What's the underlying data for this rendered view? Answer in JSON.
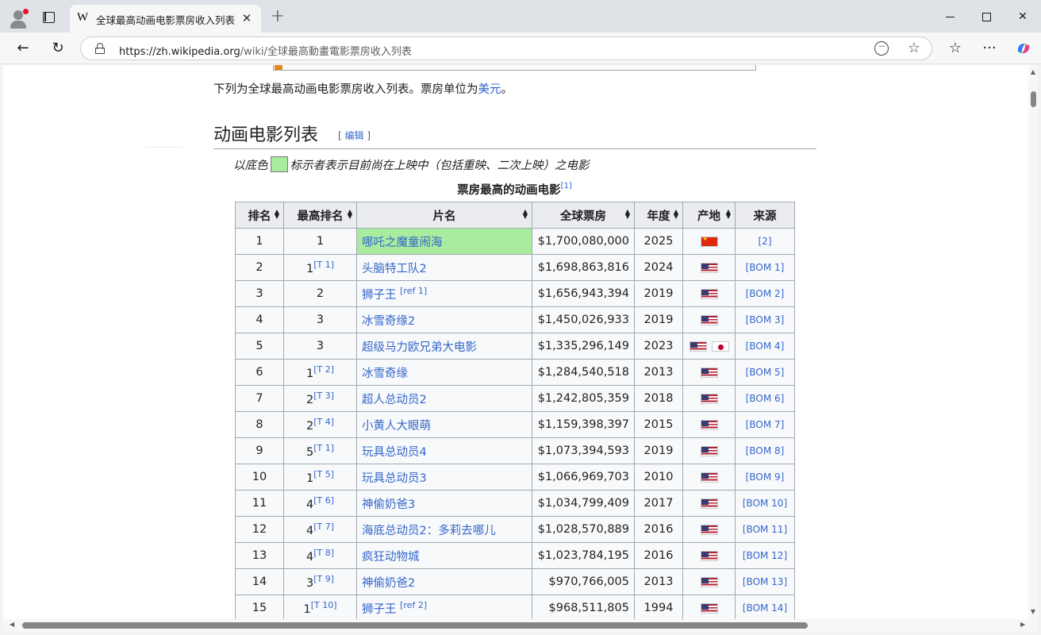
{
  "browser": {
    "tab_title": "全球最高动画电影票房收入列表 -",
    "tab_favicon": "W",
    "url_host": "https://zh.wikipedia.org",
    "url_path": "/wiki/全球最高動畫電影票房收入列表",
    "icons": {
      "profile": "profile-icon",
      "tabs": "tab-actions-icon",
      "close": "close-icon",
      "new_tab": "plus-icon",
      "back": "back-arrow-icon",
      "reload": "reload-icon",
      "lock": "lock-icon",
      "reader": "more-options-icon",
      "favorite": "star-icon",
      "favorites": "favorites-icon",
      "menu": "ellipsis-icon",
      "copilot": "copilot-icon"
    }
  },
  "article": {
    "intro_text": "下列为全球最高动画电影票房收入列表。票房单位为",
    "intro_link": "美元",
    "intro_end": "。",
    "section_title": "动画电影列表",
    "edit_open": "[",
    "edit_label": "编辑",
    "edit_close": "]",
    "note_prefix": "以底色",
    "note_suffix": "标示者表示目前尚在上映中（包括重映、二次上映）之电影",
    "caption": "票房最高的动画电影",
    "caption_ref": "[1]",
    "highlight_color": "#a9ec9f"
  },
  "table": {
    "headers": [
      "排名",
      "最高排名",
      "片名",
      "全球票房",
      "年度",
      "产地",
      "来源"
    ],
    "rows": [
      {
        "rank": "1",
        "peak": "1",
        "peak_ref": "",
        "title": "哪吒之魔童闹海",
        "title_ref": "",
        "gross": "$1,700,080,000",
        "year": "2025",
        "flags": [
          "cn"
        ],
        "src": "[2]",
        "highlight": true
      },
      {
        "rank": "2",
        "peak": "1",
        "peak_ref": "[T 1]",
        "title": "头脑特工队2",
        "title_ref": "",
        "gross": "$1,698,863,816",
        "year": "2024",
        "flags": [
          "us"
        ],
        "src": "[BOM 1]"
      },
      {
        "rank": "3",
        "peak": "2",
        "peak_ref": "",
        "title": "狮子王",
        "title_ref": "[ref 1]",
        "gross": "$1,656,943,394",
        "year": "2019",
        "flags": [
          "us"
        ],
        "src": "[BOM 2]"
      },
      {
        "rank": "4",
        "peak": "3",
        "peak_ref": "",
        "title": "冰雪奇缘2",
        "title_ref": "",
        "gross": "$1,450,026,933",
        "year": "2019",
        "flags": [
          "us"
        ],
        "src": "[BOM 3]"
      },
      {
        "rank": "5",
        "peak": "3",
        "peak_ref": "",
        "title": "超级马力欧兄弟大电影",
        "title_ref": "",
        "gross": "$1,335,296,149",
        "year": "2023",
        "flags": [
          "us",
          "jp"
        ],
        "src": "[BOM 4]"
      },
      {
        "rank": "6",
        "peak": "1",
        "peak_ref": "[T 2]",
        "title": "冰雪奇缘",
        "title_ref": "",
        "gross": "$1,284,540,518",
        "year": "2013",
        "flags": [
          "us"
        ],
        "src": "[BOM 5]"
      },
      {
        "rank": "7",
        "peak": "2",
        "peak_ref": "[T 3]",
        "title": "超人总动员2",
        "title_ref": "",
        "gross": "$1,242,805,359",
        "year": "2018",
        "flags": [
          "us"
        ],
        "src": "[BOM 6]"
      },
      {
        "rank": "8",
        "peak": "2",
        "peak_ref": "[T 4]",
        "title": "小黄人大眼萌",
        "title_ref": "",
        "gross": "$1,159,398,397",
        "year": "2015",
        "flags": [
          "us"
        ],
        "src": "[BOM 7]"
      },
      {
        "rank": "9",
        "peak": "5",
        "peak_ref": "[T 1]",
        "title": "玩具总动员4",
        "title_ref": "",
        "gross": "$1,073,394,593",
        "year": "2019",
        "flags": [
          "us"
        ],
        "src": "[BOM 8]"
      },
      {
        "rank": "10",
        "peak": "1",
        "peak_ref": "[T 5]",
        "title": "玩具总动员3",
        "title_ref": "",
        "gross": "$1,066,969,703",
        "year": "2010",
        "flags": [
          "us"
        ],
        "src": "[BOM 9]"
      },
      {
        "rank": "11",
        "peak": "4",
        "peak_ref": "[T 6]",
        "title": "神偷奶爸3",
        "title_ref": "",
        "gross": "$1,034,799,409",
        "year": "2017",
        "flags": [
          "us"
        ],
        "src": "[BOM 10]"
      },
      {
        "rank": "12",
        "peak": "4",
        "peak_ref": "[T 7]",
        "title": "海底总动员2：多莉去哪儿",
        "title_ref": "",
        "gross": "$1,028,570,889",
        "year": "2016",
        "flags": [
          "us"
        ],
        "src": "[BOM 11]"
      },
      {
        "rank": "13",
        "peak": "4",
        "peak_ref": "[T 8]",
        "title": "疯狂动物城",
        "title_ref": "",
        "gross": "$1,023,784,195",
        "year": "2016",
        "flags": [
          "us"
        ],
        "src": "[BOM 12]"
      },
      {
        "rank": "14",
        "peak": "3",
        "peak_ref": "[T 9]",
        "title": "神偷奶爸2",
        "title_ref": "",
        "gross": "$970,766,005",
        "year": "2013",
        "flags": [
          "us"
        ],
        "src": "[BOM 13]"
      },
      {
        "rank": "15",
        "peak": "1",
        "peak_ref": "[T 10]",
        "title": "狮子王",
        "title_ref": "[ref 2]",
        "gross": "$968,511,805",
        "year": "1994",
        "flags": [
          "us"
        ],
        "src": "[BOM 14]"
      }
    ]
  }
}
